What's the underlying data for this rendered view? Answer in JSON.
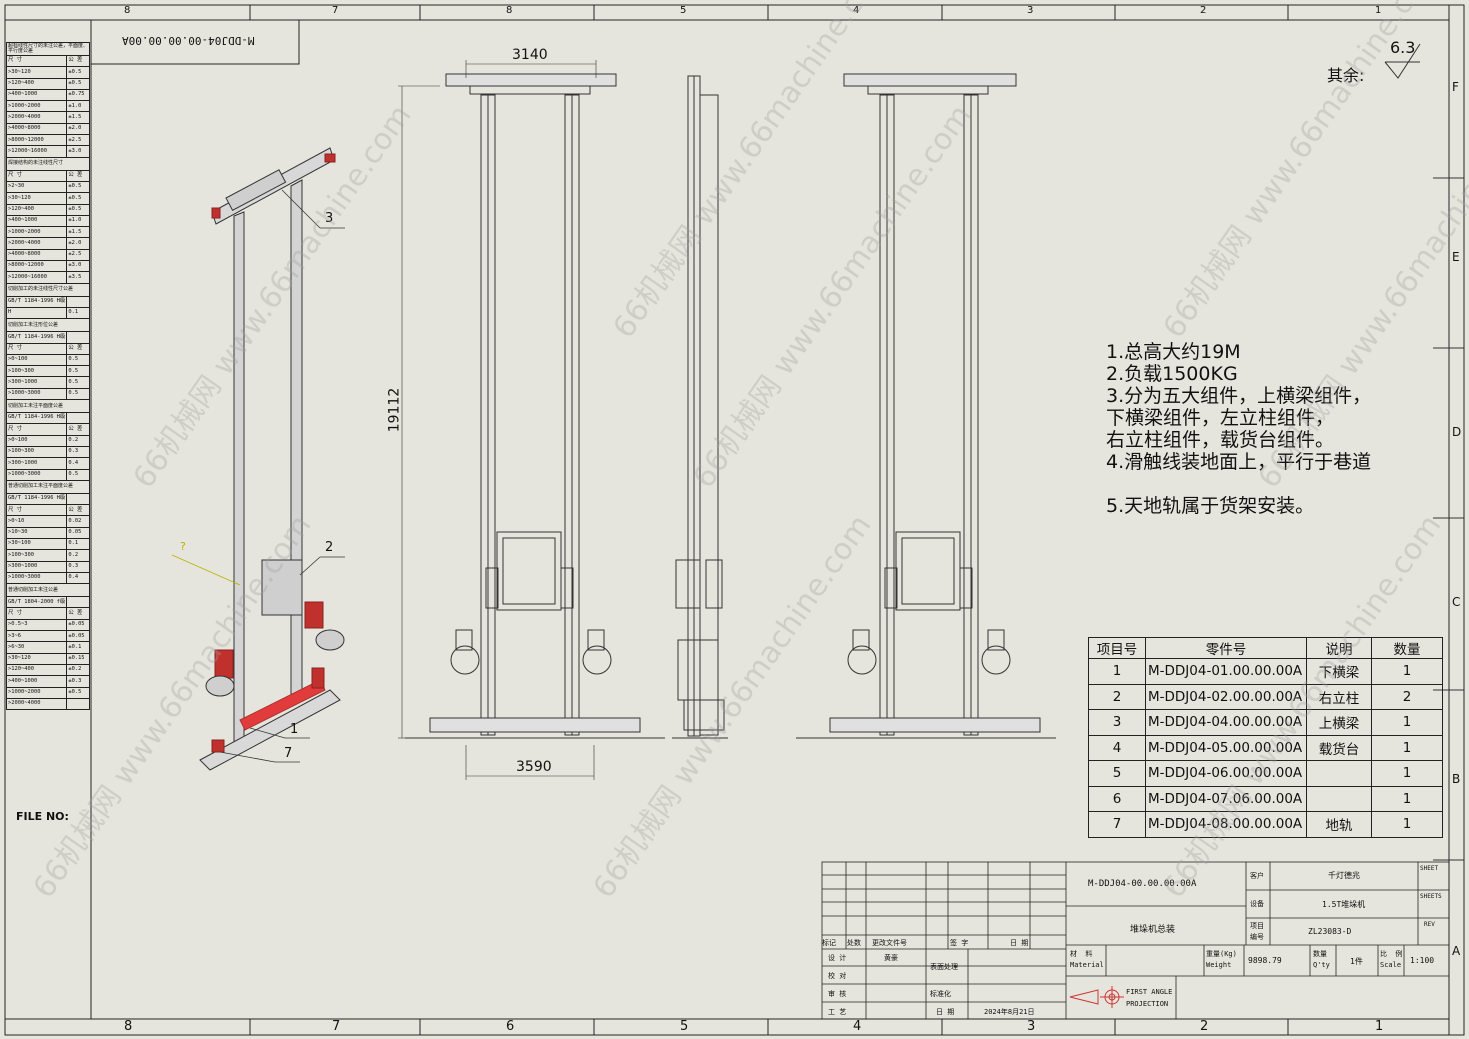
{
  "zones_top": [
    "8",
    "7",
    "8",
    "5",
    "4",
    "3",
    "2",
    "1"
  ],
  "zones_bottom": [
    "8",
    "7",
    "6",
    "5",
    "4",
    "3",
    "2",
    "1"
  ],
  "zones_right": [
    "F",
    "E",
    "D",
    "C",
    "B",
    "A"
  ],
  "title_stamp": "M-DDJ04-00.00.00.00A",
  "tolerance_table": [
    {
      "type": "h",
      "text": "超标线性尺寸的未注公差，平面度、平行度公差"
    },
    {
      "type": "r",
      "a": "尺  寸",
      "b": "公  差"
    },
    {
      "type": "r",
      "a": ">30~120",
      "b": "±0.5"
    },
    {
      "type": "r",
      "a": ">120~400",
      "b": "±0.5"
    },
    {
      "type": "r",
      "a": ">400~1000",
      "b": "±0.75"
    },
    {
      "type": "r",
      "a": ">1000~2000",
      "b": "±1.0"
    },
    {
      "type": "r",
      "a": ">2000~4000",
      "b": "±1.5"
    },
    {
      "type": "r",
      "a": ">4000~8000",
      "b": "±2.0"
    },
    {
      "type": "r",
      "a": ">8000~12000",
      "b": "±2.5"
    },
    {
      "type": "r",
      "a": ">12000~16000",
      "b": "±3.0"
    },
    {
      "type": "h",
      "text": "焊接结构的未注线性尺寸"
    },
    {
      "type": "r",
      "a": "尺  寸",
      "b": "公  差"
    },
    {
      "type": "r",
      "a": ">2~30",
      "b": "±0.5"
    },
    {
      "type": "r",
      "a": ">30~120",
      "b": "±0.5"
    },
    {
      "type": "r",
      "a": ">120~400",
      "b": "±0.5"
    },
    {
      "type": "r",
      "a": ">400~1000",
      "b": "±1.0"
    },
    {
      "type": "r",
      "a": ">1000~2000",
      "b": "±1.5"
    },
    {
      "type": "r",
      "a": ">2000~4000",
      "b": "±2.0"
    },
    {
      "type": "r",
      "a": ">4000~8000",
      "b": "±2.5"
    },
    {
      "type": "r",
      "a": ">8000~12000",
      "b": "±3.0"
    },
    {
      "type": "r",
      "a": ">12000~16000",
      "b": "±3.5"
    },
    {
      "type": "h",
      "text": "切削加工的未注线性尺寸公差"
    },
    {
      "type": "r",
      "a": "GB/T 1184-1996 H级",
      "b": ""
    },
    {
      "type": "r",
      "a": "H",
      "b": "0.1"
    },
    {
      "type": "h",
      "text": "切削加工未注形位公差"
    },
    {
      "type": "r",
      "a": "GB/T 1184-1996 H级",
      "b": ""
    },
    {
      "type": "r",
      "a": "尺  寸",
      "b": "公  差"
    },
    {
      "type": "r",
      "a": ">0~100",
      "b": "0.5"
    },
    {
      "type": "r",
      "a": ">100~300",
      "b": "0.5"
    },
    {
      "type": "r",
      "a": ">300~1000",
      "b": "0.5"
    },
    {
      "type": "r",
      "a": ">1000~3000",
      "b": "0.5"
    },
    {
      "type": "h",
      "text": "切削加工未注平面度公差"
    },
    {
      "type": "r",
      "a": "GB/T 1184-1996 H级",
      "b": ""
    },
    {
      "type": "r",
      "a": "尺  寸",
      "b": "公  差"
    },
    {
      "type": "r",
      "a": ">0~100",
      "b": "0.2"
    },
    {
      "type": "r",
      "a": ">100~300",
      "b": "0.3"
    },
    {
      "type": "r",
      "a": ">300~1000",
      "b": "0.4"
    },
    {
      "type": "r",
      "a": ">1000~3000",
      "b": "0.5"
    },
    {
      "type": "h",
      "text": "普通切削加工未注平面度公差"
    },
    {
      "type": "r",
      "a": "GB/T 1184-1996 H级",
      "b": ""
    },
    {
      "type": "r",
      "a": "尺  寸",
      "b": "公  差"
    },
    {
      "type": "r",
      "a": ">0~10",
      "b": "0.02"
    },
    {
      "type": "r",
      "a": ">10~30",
      "b": "0.05"
    },
    {
      "type": "r",
      "a": ">30~100",
      "b": "0.1"
    },
    {
      "type": "r",
      "a": ">100~300",
      "b": "0.2"
    },
    {
      "type": "r",
      "a": ">300~1000",
      "b": "0.3"
    },
    {
      "type": "r",
      "a": ">1000~3000",
      "b": "0.4"
    },
    {
      "type": "h",
      "text": "普通切削加工未注公差"
    },
    {
      "type": "r",
      "a": "GB/T 1804-2000 f级",
      "b": ""
    },
    {
      "type": "r",
      "a": "尺  寸",
      "b": "公  差"
    },
    {
      "type": "r",
      "a": ">0.5~3",
      "b": "±0.05"
    },
    {
      "type": "r",
      "a": ">3~6",
      "b": "±0.05"
    },
    {
      "type": "r",
      "a": ">6~30",
      "b": "±0.1"
    },
    {
      "type": "r",
      "a": ">30~120",
      "b": "±0.15"
    },
    {
      "type": "r",
      "a": ">120~400",
      "b": "±0.2"
    },
    {
      "type": "r",
      "a": ">400~1000",
      "b": "±0.3"
    },
    {
      "type": "r",
      "a": ">1000~2000",
      "b": "±0.5"
    },
    {
      "type": "r",
      "a": ">2000~4000",
      "b": ""
    }
  ],
  "file_no": "FILE NO:",
  "surface_finish": {
    "value": "6.3",
    "label": "其余:"
  },
  "dimensions": {
    "top_width": "3140",
    "bottom_width": "3590",
    "height": "19112"
  },
  "balloons": [
    "3",
    "2",
    "?",
    "1",
    "7"
  ],
  "notes": [
    "1.总高大约19M",
    "2.负载1500KG",
    "3.分为五大组件，上横梁组件，",
    "下横梁组件，左立柱组件，",
    "右立柱组件，载货台组件。",
    "4.滑触线装地面上，平行于巷道",
    "",
    "5.天地轨属于货架安装。"
  ],
  "bom": {
    "headers": [
      "项目号",
      "零件号",
      "说明",
      "数量"
    ],
    "rows": [
      [
        "1",
        "M-DDJ04-01.00.00.00A",
        "下横梁",
        "1"
      ],
      [
        "2",
        "M-DDJ04-02.00.00.00A",
        "右立柱",
        "2"
      ],
      [
        "3",
        "M-DDJ04-04.00.00.00A",
        "上横梁",
        "1"
      ],
      [
        "4",
        "M-DDJ04-05.00.00.00A",
        "载货台",
        "1"
      ],
      [
        "5",
        "M-DDJ04-06.00.00.00A",
        "",
        "1"
      ],
      [
        "6",
        "M-DDJ04-07.06.00.00A",
        "",
        "1"
      ],
      [
        "7",
        "M-DDJ04-08.00.00.00A",
        "地轨",
        "1"
      ]
    ]
  },
  "title_block": {
    "drawing_no": "M-DDJ04-00.00.00.00A",
    "drawing_name": "堆垛机总装",
    "customer_label": "客户",
    "customer": "千灯德兆",
    "equipment_label": "设备",
    "equipment": "1.5T堆垛机",
    "project_label": "项目\n编号",
    "project_no": "ZL23083-D",
    "sheet": "SHEET",
    "sheets": "SHEETS",
    "rev": "REV",
    "rev_table_headers": [
      "标记",
      "处数",
      "更改文件号",
      "签  字",
      "日  期"
    ],
    "roles": [
      "设  计",
      "校  对",
      "审  核",
      "工  艺"
    ],
    "designer": "黄豪",
    "surface_label": "表面处理",
    "standard_label": "标准化",
    "date_label": "日  期",
    "date": "2024年8月21日",
    "material_label": "材  料\nMaterial",
    "weight_label": "重量(Kg)\nWeight",
    "weight": "9898.79",
    "qty_label": "数量\nQ'ty",
    "qty": "1件",
    "scale_label": "比  例\nScale",
    "scale": "1:100",
    "projection": "FIRST ANGLE\nPROJECTION"
  },
  "watermark": "66机械网 www.66machine.com"
}
